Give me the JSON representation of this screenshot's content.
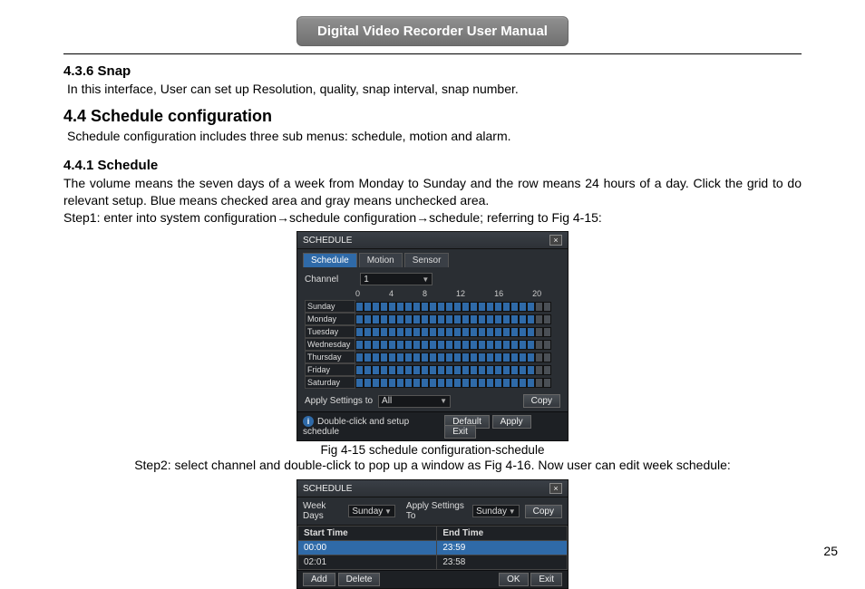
{
  "header": {
    "title": "Digital Video Recorder User Manual"
  },
  "s436": {
    "heading": "4.3.6  Snap",
    "text": "In this interface, User can set up Resolution, quality, snap interval, snap number."
  },
  "s44": {
    "heading": "4.4  Schedule configuration",
    "text": "Schedule configuration includes three sub menus: schedule, motion and alarm."
  },
  "s441": {
    "heading": "4.4.1  Schedule",
    "p1": "The volume means the seven days of a week from Monday to Sunday and the row means 24 hours of a day. Click the grid to do relevant setup. Blue means checked area and gray means unchecked area.",
    "step1_pre": "Step1: enter into system configuration",
    "arrow": "→",
    "step1_mid": "schedule configuration",
    "step1_end": "schedule; referring to Fig 4-15:",
    "caption1": "Fig 4-15 schedule configuration-schedule",
    "step2": "Step2: select channel and double-click to pop up a window as Fig 4-16. Now user can edit week schedule:"
  },
  "dlg1": {
    "title": "SCHEDULE",
    "tabs": [
      "Schedule",
      "Motion",
      "Sensor"
    ],
    "channel_label": "Channel",
    "channel_value": "1",
    "hours": [
      "0",
      "4",
      "8",
      "12",
      "16",
      "20"
    ],
    "days": [
      "Sunday",
      "Monday",
      "Tuesday",
      "Wednesday",
      "Thursday",
      "Friday",
      "Saturday"
    ],
    "apply_label": "Apply  Settings  to",
    "apply_value": "All",
    "copy": "Copy",
    "hint": "Double-click  and  setup  schedule",
    "btn_default": "Default",
    "btn_apply": "Apply",
    "btn_exit": "Exit"
  },
  "dlg2": {
    "title": "SCHEDULE",
    "weekdays_label": "Week Days",
    "weekdays_value": "Sunday",
    "apply_label": "Apply  Settings  To",
    "apply_value": "Sunday",
    "copy": "Copy",
    "col_start": "Start  Time",
    "col_end": "End  Time",
    "rows": [
      {
        "start": "00:00",
        "end": "23:59"
      },
      {
        "start": "02:01",
        "end": "23:58"
      }
    ],
    "btn_add": "Add",
    "btn_delete": "Delete",
    "btn_ok": "OK",
    "btn_exit": "Exit"
  },
  "page": "25"
}
